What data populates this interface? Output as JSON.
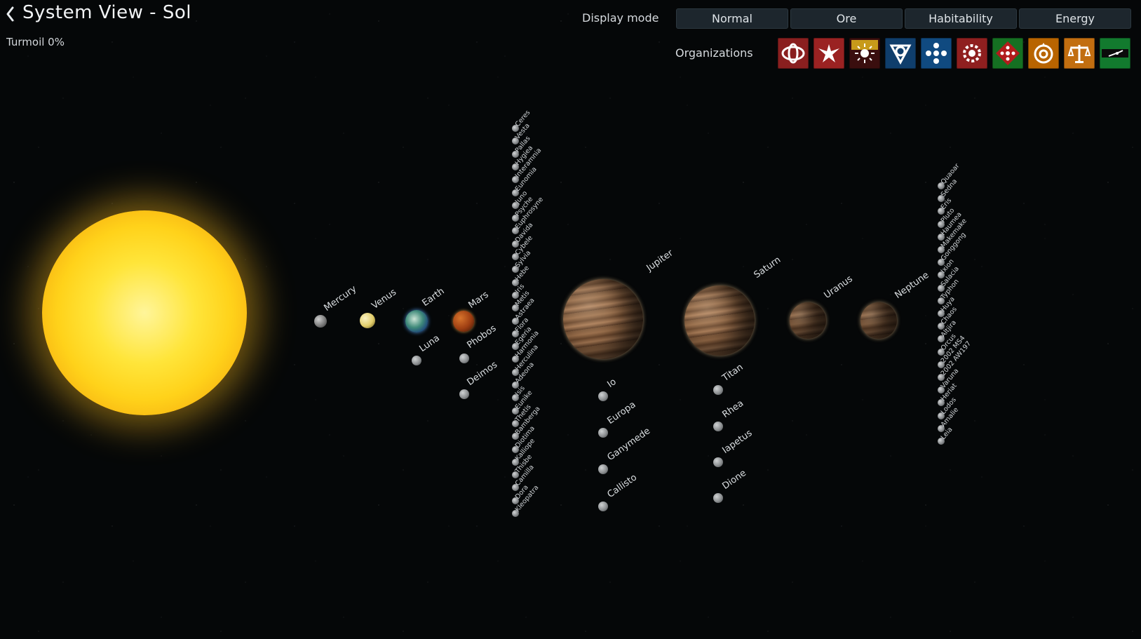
{
  "header": {
    "title": "System View - Sol",
    "turmoil": "Turmoil 0%"
  },
  "display_mode": {
    "label": "Display mode",
    "options": [
      "Normal",
      "Ore",
      "Habitability",
      "Energy"
    ]
  },
  "organizations": {
    "label": "Organizations",
    "colors": [
      "#8a1f1f",
      "#9a2222",
      "#3a0e0e",
      "#0f3e6c",
      "#104a80",
      "#8f1f1f",
      "#157022",
      "#b86400",
      "#c26e10",
      "#127a2e"
    ]
  },
  "colors": {
    "sun": "#ffd21a",
    "panel": "#1d262d",
    "text": "#e8ecef"
  },
  "bodies": {
    "mercury": "Mercury",
    "venus": "Venus",
    "earth": "Earth",
    "mars": "Mars",
    "luna": "Luna",
    "phobos": "Phobos",
    "deimos": "Deimos",
    "jupiter": "Jupiter",
    "saturn": "Saturn",
    "uranus": "Uranus",
    "neptune": "Neptune"
  },
  "jupiter_moons": [
    "Io",
    "Europa",
    "Ganymede",
    "Callisto"
  ],
  "saturn_moons": [
    "Titan",
    "Rhea",
    "Iapetus",
    "Dione"
  ],
  "asteroid_belt": [
    "Ceres",
    "Vesta",
    "Pallas",
    "Hygiea",
    "Interamnia",
    "Eunomia",
    "Juno",
    "Psyche",
    "Euphrosyne",
    "Davida",
    "Cybele",
    "Sylvia",
    "Hebe",
    "Iris",
    "Metis",
    "Astraea",
    "Flora",
    "Egeria",
    "Harmonia",
    "Herculina",
    "Adeona",
    "Isis",
    "Eunike",
    "Thetis",
    "Bamberga",
    "Diotima",
    "Kalliope",
    "Thisbe",
    "Camilla",
    "Dora",
    "Kleopatra"
  ],
  "kuiper_belt": [
    "Quaoar",
    "Sedna",
    "Eris",
    "Pluto",
    "Haumea",
    "Makemake",
    "Gonggong",
    "Ixion",
    "Salacia",
    "Typhon",
    "Huya",
    "Chaos",
    "Altjira",
    "Orcus",
    "2002 MS4",
    "2002 AW197",
    "Varuna",
    "Heriat",
    "Lodos",
    "Amalie",
    "Leia"
  ]
}
